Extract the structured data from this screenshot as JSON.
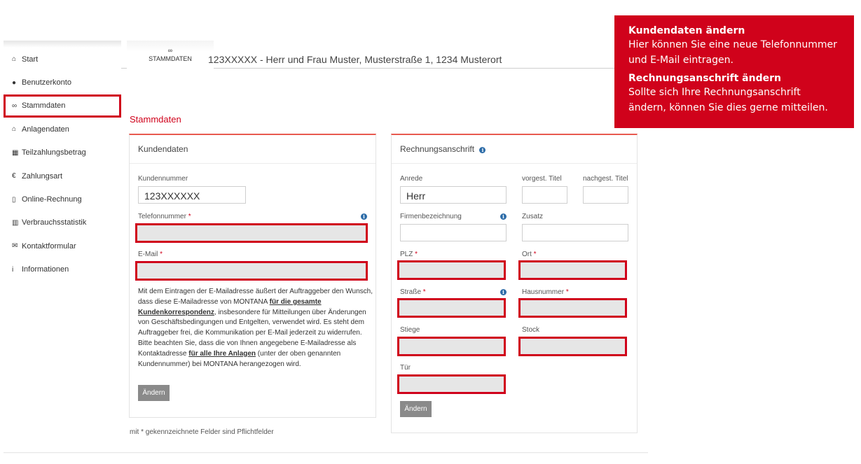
{
  "sidebar": {
    "items": [
      {
        "label": "Start",
        "icon": "home-icon",
        "glyph": "⌂"
      },
      {
        "label": "Benutzerkonto",
        "icon": "user-icon",
        "glyph": "●"
      },
      {
        "label": "Stammdaten",
        "icon": "handshake-icon",
        "glyph": "∞",
        "active": true
      },
      {
        "label": "Anlagendaten",
        "icon": "house-icon",
        "glyph": "⌂"
      },
      {
        "label": "Teilzahlungsbetrag",
        "icon": "calculator-icon",
        "glyph": "▦"
      },
      {
        "label": "Zahlungsart",
        "icon": "euro-icon",
        "glyph": "€"
      },
      {
        "label": "Online-Rechnung",
        "icon": "document-icon",
        "glyph": "▯"
      },
      {
        "label": "Verbrauchsstatistik",
        "icon": "bar-chart-icon",
        "glyph": "▥"
      },
      {
        "label": "Kontaktformular",
        "icon": "envelope-icon",
        "glyph": "✉"
      },
      {
        "label": "Informationen",
        "icon": "info-icon",
        "glyph": "i"
      }
    ]
  },
  "header": {
    "tab_label": "STAMMDATEN",
    "tab_icon": "handshake-icon",
    "customer_line": "123XXXXX - Herr und Frau Muster, Musterstraße 1, 1234 Musterort"
  },
  "section_title": "Stammdaten",
  "kundendaten": {
    "title": "Kundendaten",
    "kundennummer_label": "Kundennummer",
    "kundennummer_value": "123XXXXXX",
    "telefon_label": "Telefonnummer",
    "email_label": "E-Mail",
    "required_mark": "*",
    "info_p1_a": "Mit dem Eintragen der E-Mailadresse äußert der Auftraggeber den Wunsch, dass diese E-Mailadresse von MONTANA ",
    "info_p1_b": "für die gesamte Kundenkorrespondenz",
    "info_p1_c": ", insbesondere für Mitteilungen über Änderungen von Geschäftsbedingungen und Entgelten, verwendet wird. Es steht dem Auftraggeber frei, die Kommunikation per E-Mail jederzeit zu widerrufen.",
    "info_p2_a": "Bitte beachten Sie, dass die von Ihnen angegebene E-Mailadresse als Kontaktadresse ",
    "info_p2_b": "für alle Ihre Anlagen",
    "info_p2_c": " (unter der oben genannten Kundennummer) bei MONTANA herangezogen wird.",
    "button": "Ändern"
  },
  "rechnung": {
    "title": "Rechnungsanschrift",
    "anrede_label": "Anrede",
    "anrede_value": "Herr",
    "vorgest_label": "vorgest. Titel",
    "nachgest_label": "nachgest. Titel",
    "firma_label": "Firmenbezeichnung",
    "zusatz_label": "Zusatz",
    "plz_label": "PLZ",
    "ort_label": "Ort",
    "strasse_label": "Straße",
    "hausnummer_label": "Hausnummer",
    "stiege_label": "Stiege",
    "stock_label": "Stock",
    "tuer_label": "Tür",
    "button": "Ändern"
  },
  "footnote": "mit * gekennzeichnete Felder sind Pflichtfelder",
  "callout": {
    "title1": "Kundendaten ändern",
    "body1": "Hier können Sie eine neue Telefonnummer und E-Mail eintragen.",
    "title2": "Rechnungsanschrift ändern",
    "body2": "Sollte sich Ihre Rechnungsanschrift ändern, können Sie dies gerne mitteilen.",
    "color": "#d0021b"
  },
  "colors": {
    "accent": "#d0021b",
    "button": "#8a8a8a",
    "info": "#2d6ca8"
  }
}
